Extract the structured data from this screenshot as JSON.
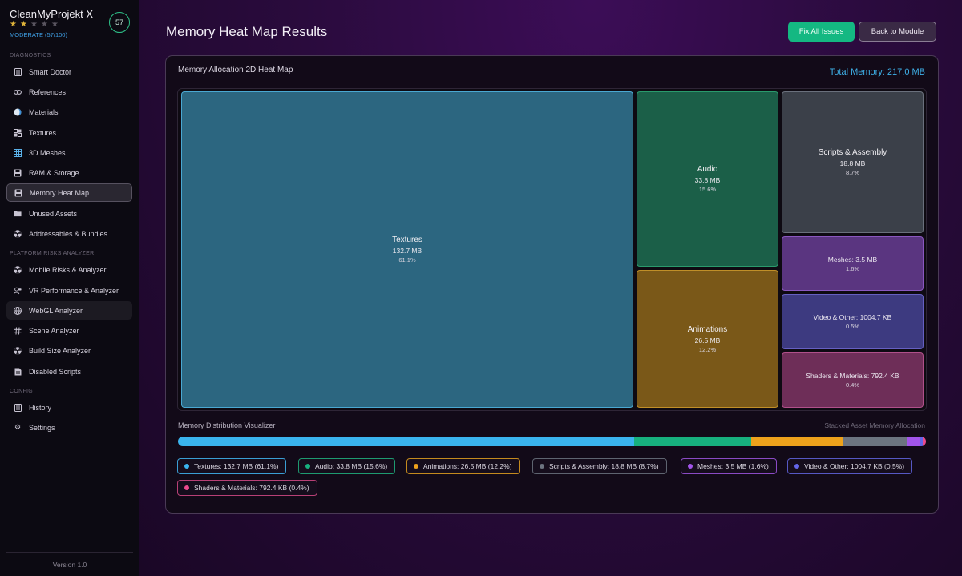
{
  "app": {
    "title": "CleanMyProjekt X",
    "rating_stars_filled": 2,
    "rating_stars_total": 5,
    "health_text": "MODERATE (57/100)",
    "score": "57"
  },
  "sidebar": {
    "sections": [
      {
        "label": "DIAGNOSTICS",
        "items": [
          {
            "label": "Smart Doctor",
            "icon": "document-icon"
          },
          {
            "label": "References",
            "icon": "link-icon"
          },
          {
            "label": "Materials",
            "icon": "sphere-icon"
          },
          {
            "label": "Textures",
            "icon": "checker-icon"
          },
          {
            "label": "3D Meshes",
            "icon": "grid-icon"
          },
          {
            "label": "RAM & Storage",
            "icon": "floppy-icon"
          },
          {
            "label": "Memory Heat Map",
            "icon": "floppy-icon",
            "active": true
          },
          {
            "label": "Unused Assets",
            "icon": "folder-icon"
          },
          {
            "label": "Addressables & Bundles",
            "icon": "radiation-icon"
          }
        ]
      },
      {
        "label": "PLATFORM RISKS ANALYZER",
        "items": [
          {
            "label": "Mobile Risks & Analyzer",
            "icon": "radiation-icon"
          },
          {
            "label": "VR Performance & Analyzer",
            "icon": "vr-icon"
          },
          {
            "label": "WebGL Analyzer",
            "icon": "globe-icon",
            "hover": true
          },
          {
            "label": "Scene Analyzer",
            "icon": "hash-icon"
          },
          {
            "label": "Build Size Analyzer",
            "icon": "radiation-icon"
          },
          {
            "label": "Disabled Scripts",
            "icon": "script-icon"
          }
        ]
      },
      {
        "label": "CONFIG",
        "items": [
          {
            "label": "History",
            "icon": "document-icon"
          },
          {
            "label": "Settings",
            "icon": "gear-icon"
          }
        ]
      }
    ],
    "version": "Version 1.0"
  },
  "header": {
    "title": "Memory Heat Map Results",
    "fix_all_label": "Fix All Issues",
    "back_label": "Back to Module"
  },
  "heatmap": {
    "title": "Memory Allocation 2D Heat Map",
    "total": "Total Memory: 217.0 MB",
    "tiles": [
      {
        "name": "Textures",
        "size": "132.7 MB",
        "pct": "61.1%",
        "color": "#2c6680",
        "border": "#4aa8d2"
      },
      {
        "name": "Audio",
        "size": "33.8 MB",
        "pct": "15.6%",
        "color": "#1b5f48",
        "border": "#2a9a6c"
      },
      {
        "name": "Animations",
        "size": "26.5 MB",
        "pct": "12.2%",
        "color": "#7a5818",
        "border": "#c08f28"
      },
      {
        "name": "Scripts & Assembly",
        "size": "18.8 MB",
        "pct": "8.7%",
        "color": "#3b4049",
        "border": "#6a707c"
      },
      {
        "line": "Meshes: 3.5 MB",
        "pct": "1.6%",
        "color": "#5a3580",
        "border": "#8a58c0"
      },
      {
        "line": "Video & Other: 1004.7 KB",
        "pct": "0.5%",
        "color": "#3d3a80",
        "border": "#6660c2"
      },
      {
        "line": "Shaders & Materials: 792.4 KB",
        "pct": "0.4%",
        "color": "#6e2e58",
        "border": "#b0508a"
      }
    ]
  },
  "distribution": {
    "title": "Memory Distribution Visualizer",
    "subtitle": "Stacked Asset Memory Allocation",
    "segments": [
      {
        "label": "Textures: 132.7 MB (61.1%)",
        "share": 61.1,
        "color": "#3ab4ee",
        "chip_border": "#3a9ed4"
      },
      {
        "label": "Audio: 33.8 MB (15.6%)",
        "share": 15.6,
        "color": "#17b07e",
        "chip_border": "#1e9a70"
      },
      {
        "label": "Animations: 26.5 MB (12.2%)",
        "share": 12.2,
        "color": "#eea21c",
        "chip_border": "#c48a1e"
      },
      {
        "label": "Scripts & Assembly: 18.8 MB (8.7%)",
        "share": 8.7,
        "color": "#6c7480",
        "chip_border": "#5e6470"
      },
      {
        "label": "Meshes: 3.5 MB (1.6%)",
        "share": 1.6,
        "color": "#a254ea",
        "chip_border": "#8a4ac4"
      },
      {
        "label": "Video & Other: 1004.7 KB (0.5%)",
        "share": 0.5,
        "color": "#6466e8",
        "chip_border": "#5658c4"
      },
      {
        "label": "Shaders & Materials: 792.4 KB (0.4%)",
        "share": 0.4,
        "color": "#ec4a8e",
        "chip_border": "#b84076"
      }
    ]
  }
}
